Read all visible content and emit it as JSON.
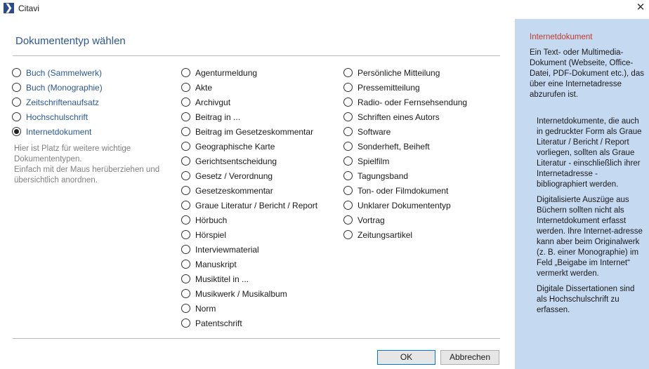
{
  "window": {
    "title": "Citavi",
    "icon": "citavi-logo-icon"
  },
  "dialog": {
    "title": "Dokumententyp wählen",
    "hint": "Hier ist Platz für weitere wichtige Dokumententypen.\nEinfach mit der Maus herüberziehen und übersichtlich anordnen."
  },
  "column1": [
    {
      "label": "Buch (Sammelwerk)",
      "checked": false
    },
    {
      "label": "Buch (Monographie)",
      "checked": false
    },
    {
      "label": "Zeitschriftenaufsatz",
      "checked": false
    },
    {
      "label": "Hochschulschrift",
      "checked": false
    },
    {
      "label": "Internetdokument",
      "checked": true
    }
  ],
  "column2": [
    {
      "label": "Agenturmeldung"
    },
    {
      "label": "Akte"
    },
    {
      "label": "Archivgut"
    },
    {
      "label": "Beitrag in ..."
    },
    {
      "label": "Beitrag im Gesetzeskommentar"
    },
    {
      "label": "Geographische Karte"
    },
    {
      "label": "Gerichtsentscheidung"
    },
    {
      "label": "Gesetz / Verordnung"
    },
    {
      "label": "Gesetzeskommentar"
    },
    {
      "label": "Graue Literatur / Bericht / Report"
    },
    {
      "label": "Hörbuch"
    },
    {
      "label": "Hörspiel"
    },
    {
      "label": "Interviewmaterial"
    },
    {
      "label": "Manuskript"
    },
    {
      "label": "Musiktitel in ..."
    },
    {
      "label": "Musikwerk / Musikalbum"
    },
    {
      "label": "Norm"
    },
    {
      "label": "Patentschrift"
    }
  ],
  "column3": [
    {
      "label": "Persönliche Mitteilung"
    },
    {
      "label": "Pressemitteilung"
    },
    {
      "label": "Radio- oder Fernsehsendung"
    },
    {
      "label": "Schriften eines Autors"
    },
    {
      "label": "Software"
    },
    {
      "label": "Sonderheft, Beiheft"
    },
    {
      "label": "Spielfilm"
    },
    {
      "label": "Tagungsband"
    },
    {
      "label": "Ton- oder Filmdokument"
    },
    {
      "label": "Unklarer Dokumententyp"
    },
    {
      "label": "Vortrag"
    },
    {
      "label": "Zeitungsartikel"
    }
  ],
  "buttons": {
    "ok": "OK",
    "cancel": "Abbrechen"
  },
  "info": {
    "title": "Internetdokument",
    "lead": "Ein Text- oder Multimedia-Dokument (Webseite, Office-Datei, PDF-Dokument etc.), das über eine Internetadresse abzurufen ist.",
    "paragraphs": [
      "Internetdokumente, die auch in gedruckter Form als Graue Literatur / Bericht / Report vorliegen, sollten als Graue Literatur - einschließlich ihrer Internetadresse - bibliographiert werden.",
      "Digitalisierte Auszüge aus Büchern sollten nicht als Internetdokument erfasst werden. Ihre Internet-adresse kann aber beim Originalwerk (z. B. einer Monographie) im Feld „Beigabe im Internet“ vermerkt werden.",
      "Digitale Dissertationen sind als Hochschulschrift zu erfassen."
    ]
  },
  "colors": {
    "accent": "#2b5797",
    "info_panel_bg": "#c5d9f1",
    "info_title": "#c0392b",
    "hint_text": "#808080"
  }
}
